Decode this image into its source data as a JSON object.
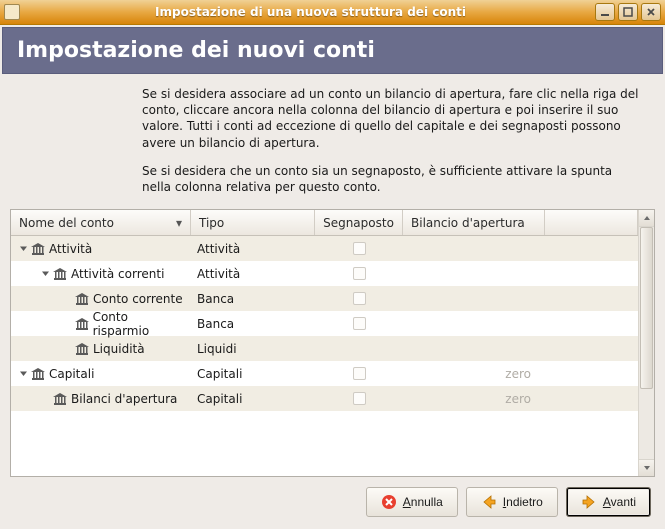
{
  "window": {
    "title": "Impostazione di una nuova struttura dei conti"
  },
  "header": {
    "title": "Impostazione dei nuovi conti"
  },
  "description": {
    "p1": "Se si desidera associare ad un conto un bilancio di apertura, fare clic nella riga del conto, cliccare ancora nella colonna del bilancio di apertura e poi inserire il suo valore. Tutti i conti ad eccezione di quello del capitale e dei segnaposti possono avere un bilancio di apertura.",
    "p2": "Se si desidera che un conto sia un segnaposto, è sufficiente attivare la spunta nella colonna relativa per questo conto."
  },
  "columns": {
    "name": "Nome del conto",
    "type": "Tipo",
    "placeholder": "Segnaposto",
    "balance": "Bilancio d'apertura"
  },
  "rows": [
    {
      "indent": 0,
      "expander": "down",
      "name": "Attività",
      "type": "Attività",
      "checkbox": true,
      "balance": ""
    },
    {
      "indent": 1,
      "expander": "down",
      "name": "Attività correnti",
      "type": "Attività",
      "checkbox": true,
      "balance": ""
    },
    {
      "indent": 2,
      "expander": "none",
      "name": "Conto corrente",
      "type": "Banca",
      "checkbox": true,
      "balance": ""
    },
    {
      "indent": 2,
      "expander": "none",
      "name": "Conto risparmio",
      "type": "Banca",
      "checkbox": true,
      "balance": ""
    },
    {
      "indent": 2,
      "expander": "none",
      "name": "Liquidità",
      "type": "Liquidi",
      "checkbox": false,
      "balance": ""
    },
    {
      "indent": 0,
      "expander": "down",
      "name": "Capitali",
      "type": "Capitali",
      "checkbox": true,
      "balance": "zero"
    },
    {
      "indent": 1,
      "expander": "none",
      "name": "Bilanci d'apertura",
      "type": "Capitali",
      "checkbox": true,
      "balance": "zero"
    }
  ],
  "buttons": {
    "cancel_pre": "A",
    "cancel_post": "nnulla",
    "back_pre": "I",
    "back_post": "ndietro",
    "forward_pre": "A",
    "forward_post": "vanti"
  }
}
